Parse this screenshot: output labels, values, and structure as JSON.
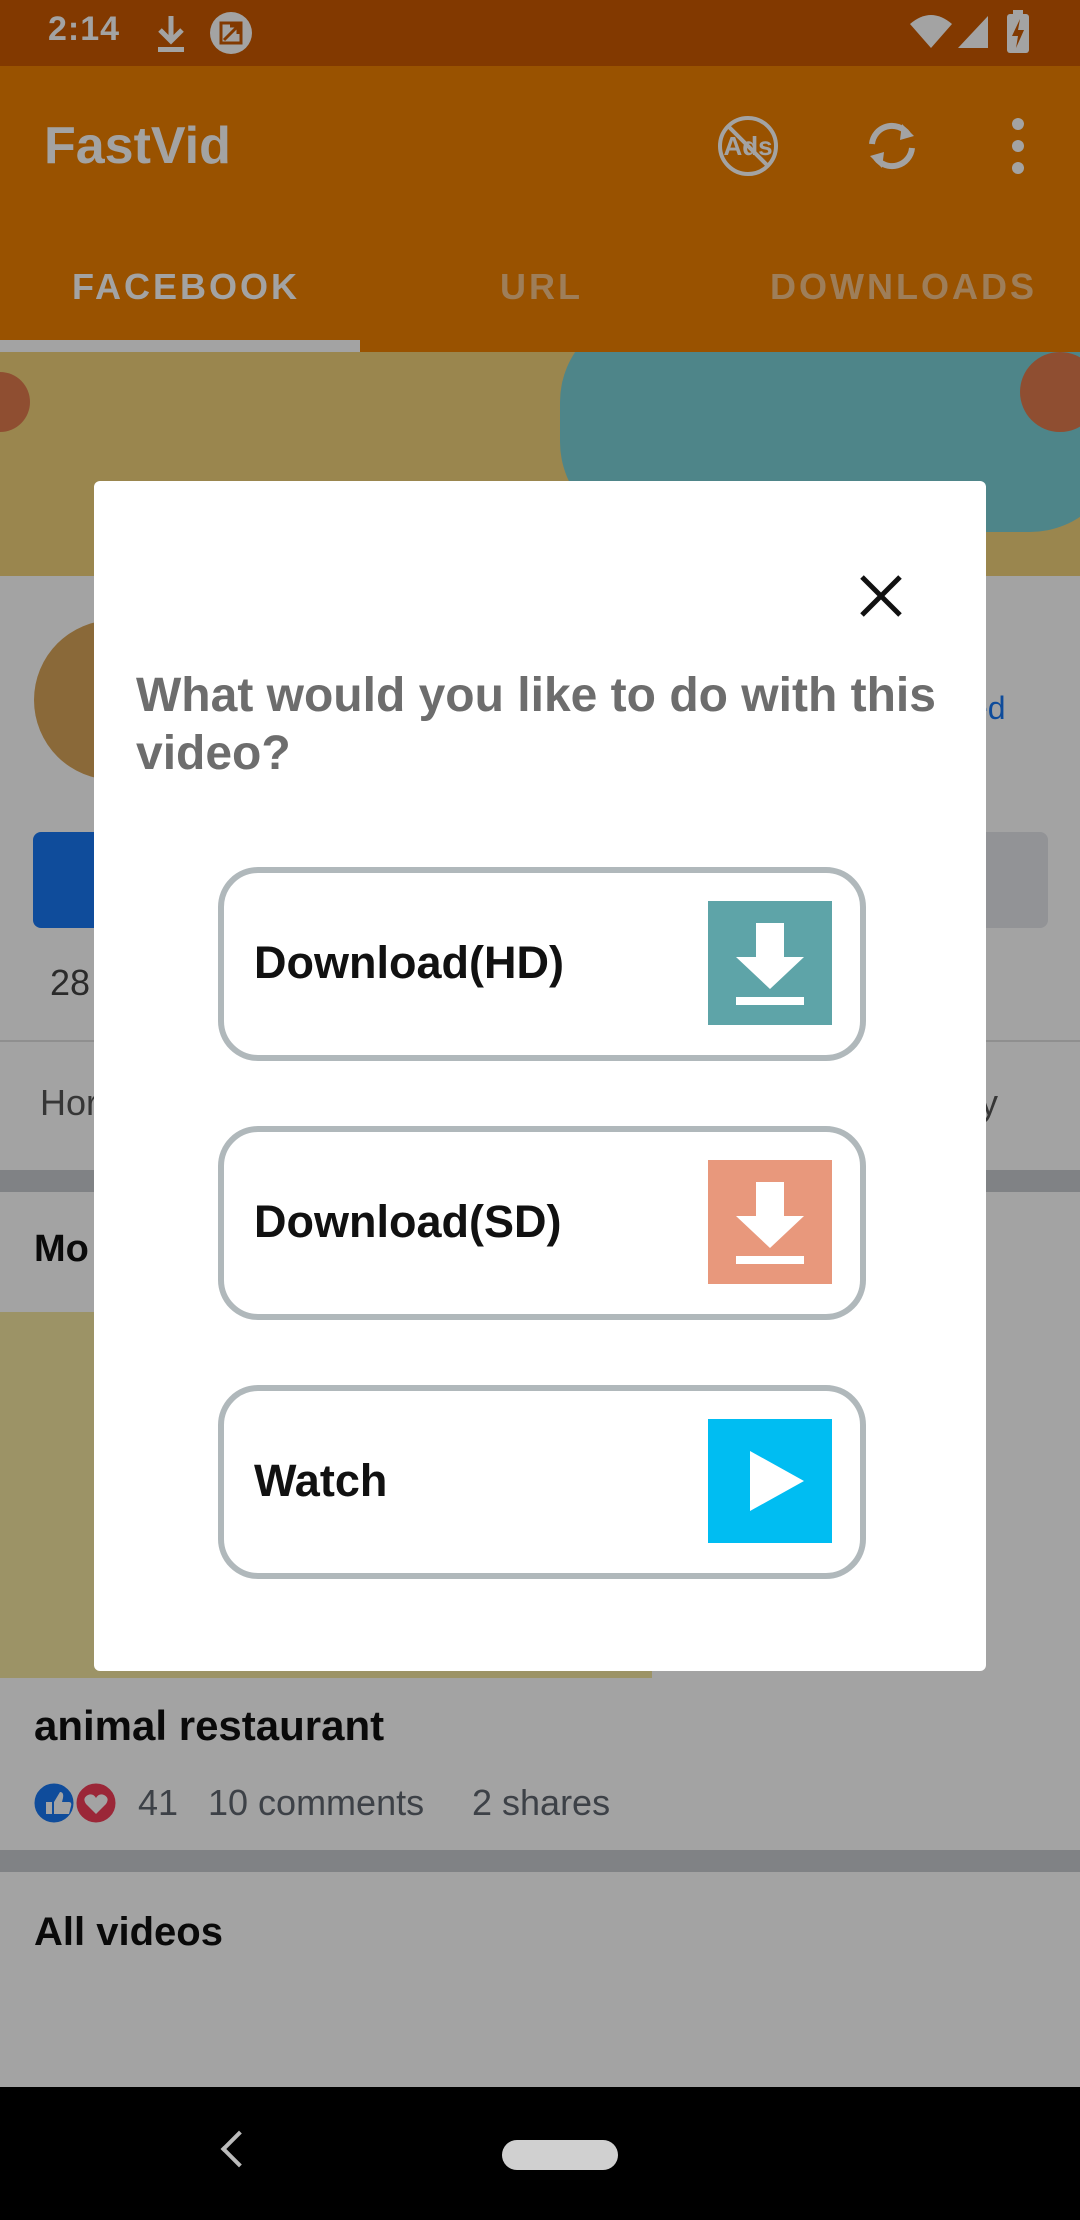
{
  "status_bar": {
    "time": "2:14",
    "icons": [
      "download-icon",
      "screenshot-icon",
      "wifi-icon",
      "cell-signal-icon",
      "battery-charging-icon"
    ]
  },
  "app_bar": {
    "title": "FastVid",
    "actions": [
      "no-ads-icon",
      "refresh-icon",
      "overflow-menu-icon"
    ],
    "tabs": [
      {
        "label": "FACEBOOK",
        "selected": true
      },
      {
        "label": "URL",
        "selected": false
      },
      {
        "label": "DOWNLOADS",
        "selected": false
      }
    ]
  },
  "background_page": {
    "followers_partial": "28",
    "tab_partial_left": "Hor",
    "tab_partial_right": "y",
    "name_link_partial": "ed",
    "section_partial": "Mo",
    "video_title": "animal restaurant",
    "reactions_count": "41",
    "comments": "10 comments",
    "shares": "2 shares",
    "all_videos": "All videos"
  },
  "dialog": {
    "question": "What would you like to do with this video?",
    "options": [
      {
        "label": "Download(HD)",
        "icon": "download-icon",
        "color": "#5ea4a8"
      },
      {
        "label": "Download(SD)",
        "icon": "download-icon",
        "color": "#e8987c"
      },
      {
        "label": "Watch",
        "icon": "play-icon",
        "color": "#00bdf2"
      }
    ]
  },
  "colors": {
    "primary": "#f08000",
    "status_bar": "#cb5a00"
  }
}
